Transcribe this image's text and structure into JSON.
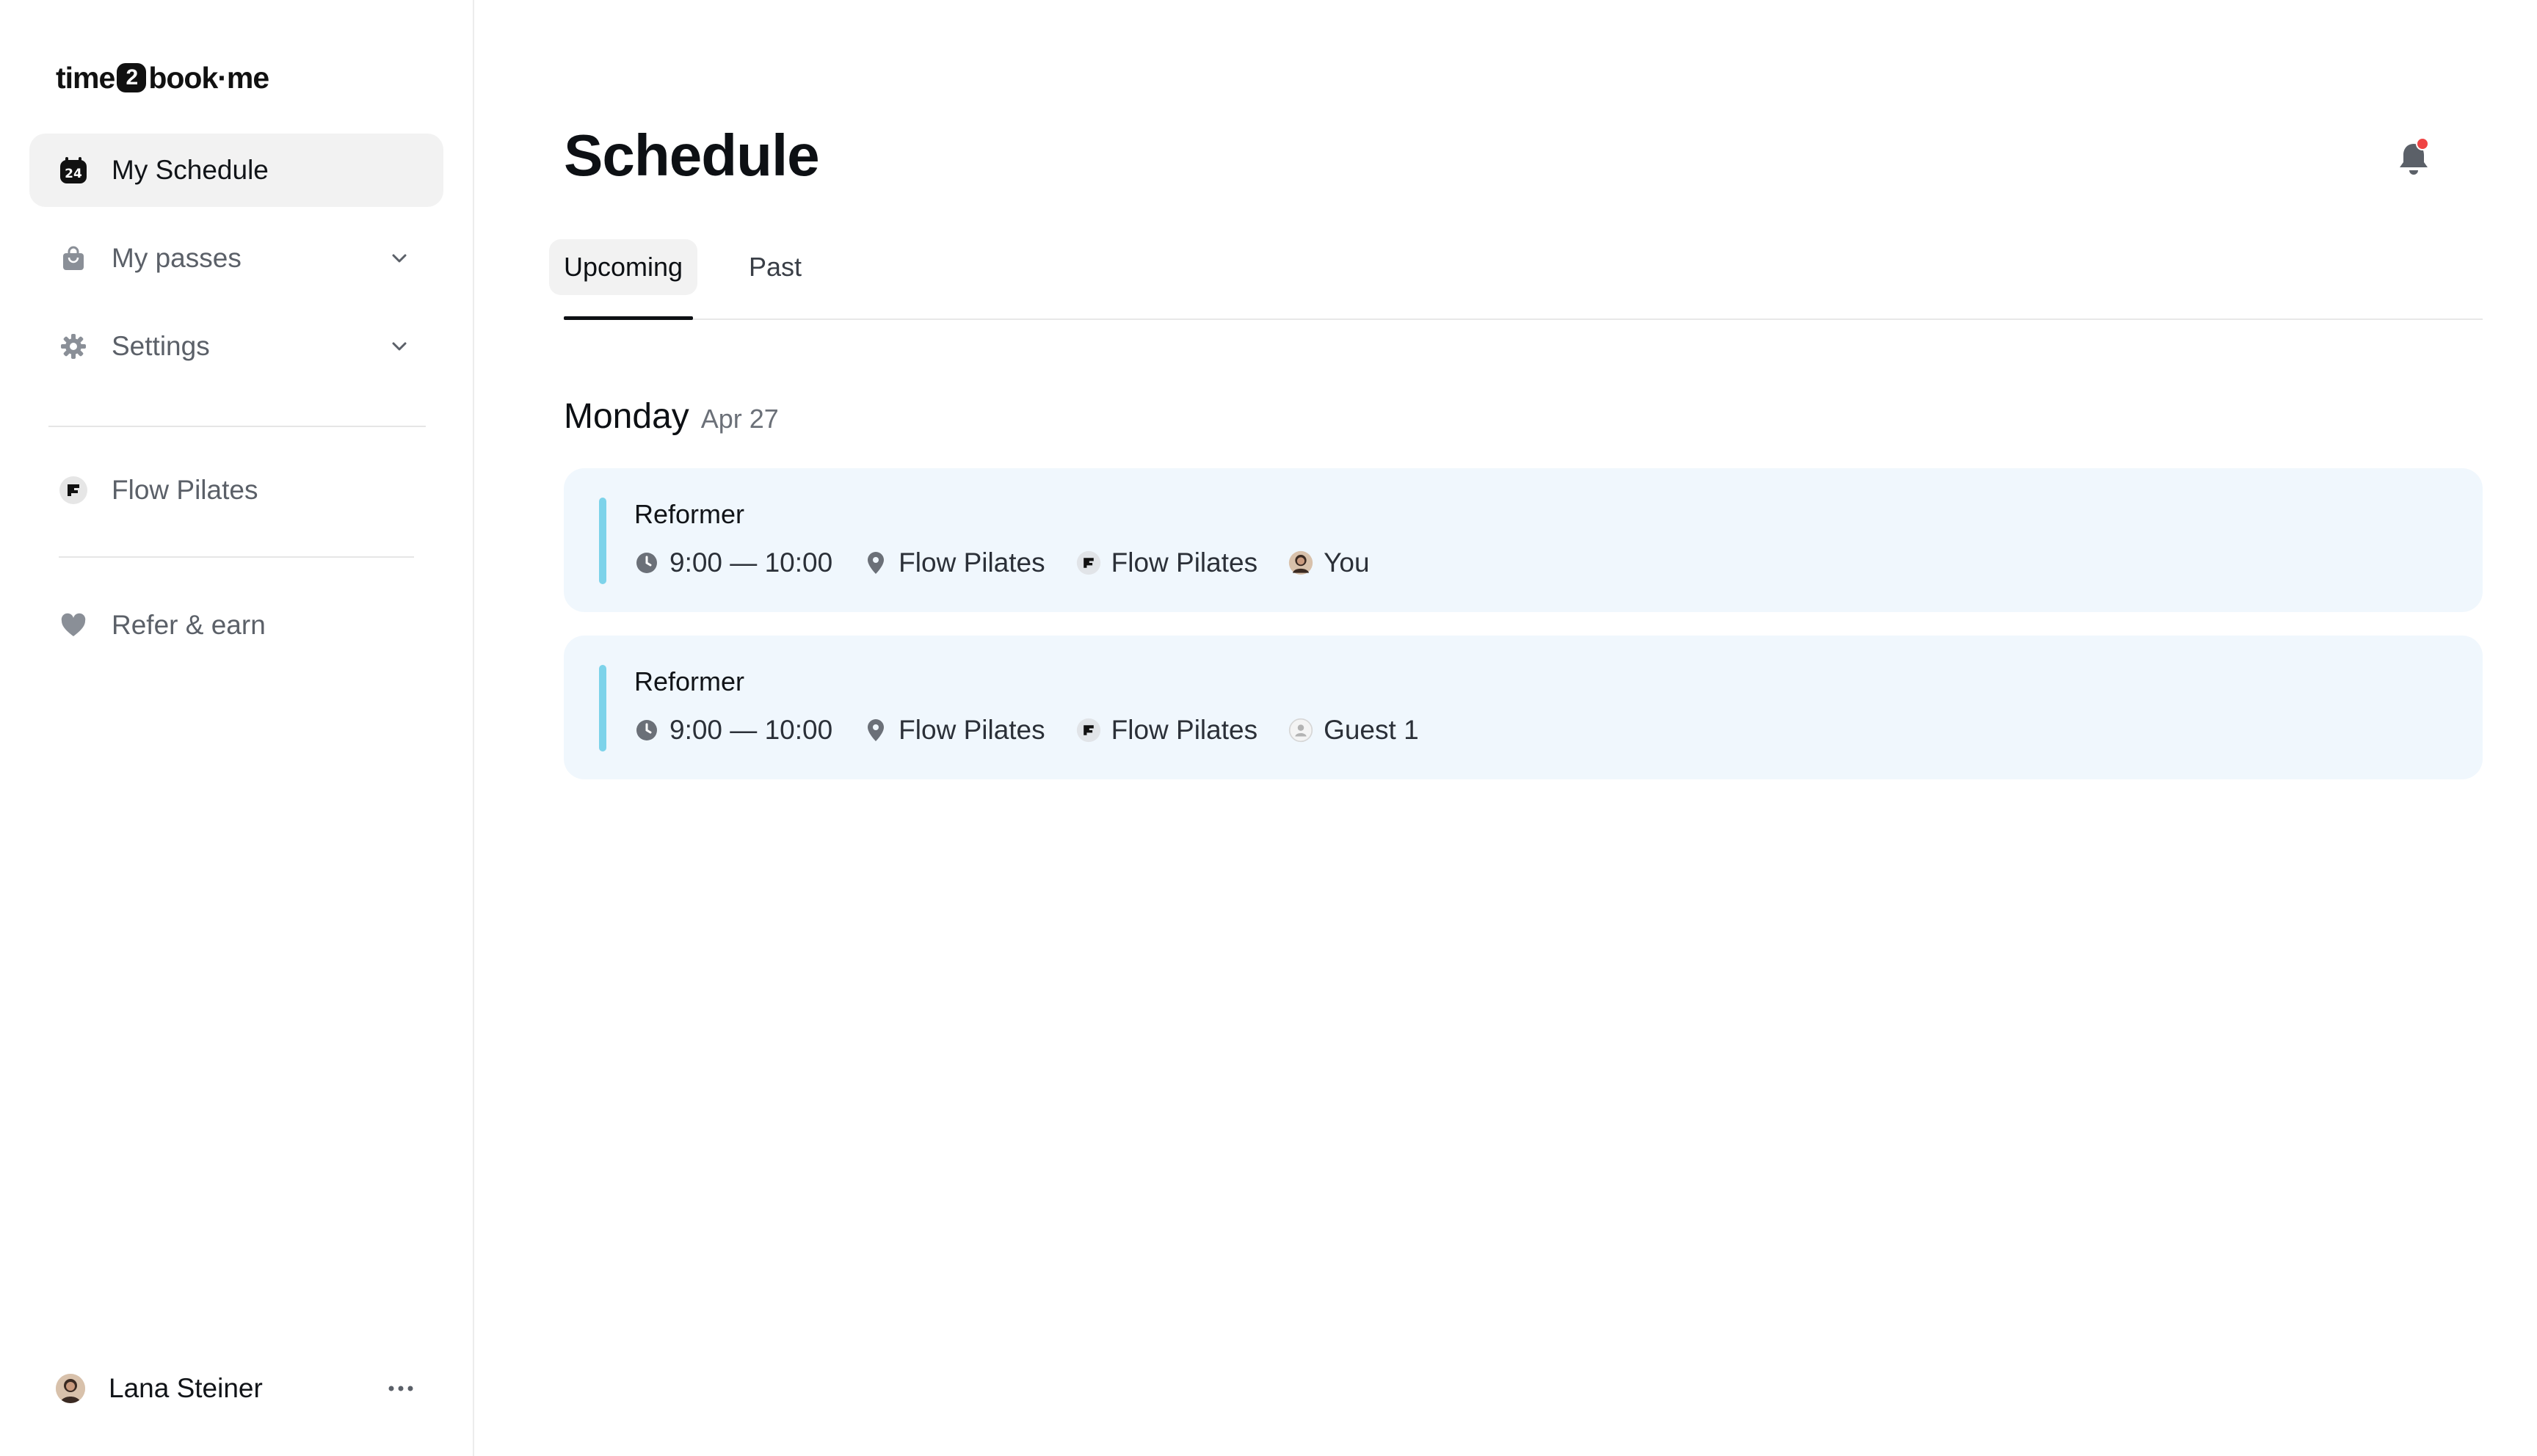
{
  "brand": {
    "part1": "time",
    "part2": "2",
    "part3": "book·me"
  },
  "sidebar": {
    "items": [
      {
        "label": "My Schedule",
        "icon": "calendar-24-icon"
      },
      {
        "label": "My passes",
        "icon": "bag-icon"
      },
      {
        "label": "Settings",
        "icon": "gear-icon"
      },
      {
        "label": "Flow Pilates",
        "icon": "studio-logo-icon"
      },
      {
        "label": "Refer & earn",
        "icon": "heart-icon"
      }
    ],
    "user": {
      "name": "Lana Steiner"
    }
  },
  "main": {
    "title": "Schedule",
    "tabs": [
      {
        "label": "Upcoming"
      },
      {
        "label": "Past"
      }
    ],
    "day": {
      "name": "Monday",
      "date": "Apr 27"
    },
    "sessions": [
      {
        "class_name": "Reformer",
        "time": "9:00 — 10:00",
        "location": "Flow Pilates",
        "studio": "Flow Pilates",
        "attendee": "You"
      },
      {
        "class_name": "Reformer",
        "time": "9:00 — 10:00",
        "location": "Flow Pilates",
        "studio": "Flow Pilates",
        "attendee": "Guest 1"
      }
    ]
  },
  "colors": {
    "accent_bar": "#7dd3ea",
    "card_bg": "#f0f7fd",
    "notification_dot": "#ef4444"
  }
}
